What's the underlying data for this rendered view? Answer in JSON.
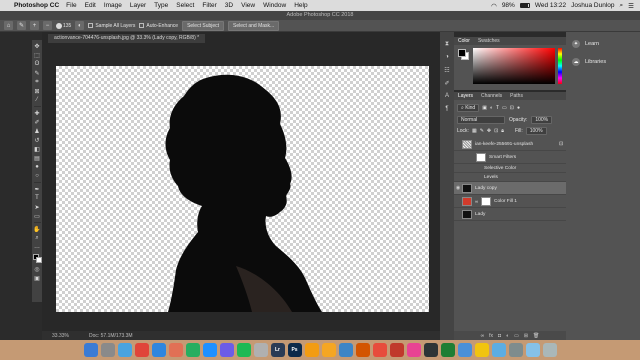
{
  "menubar": {
    "app_name": "Photoshop CC",
    "items": [
      "File",
      "Edit",
      "Image",
      "Layer",
      "Type",
      "Select",
      "Filter",
      "3D",
      "View",
      "Window",
      "Help"
    ],
    "battery": "98%",
    "clock": "Wed 13:22",
    "user": "Joshua Dunlop"
  },
  "window_title": "Adobe Photoshop CC 2018",
  "options": {
    "brush_size": "135",
    "sample_all_layers": "Sample All Layers",
    "auto_enhance": "Auto-Enhance",
    "select_subject": "Select Subject",
    "select_and_mask": "Select and Mask..."
  },
  "document": {
    "tab_title": "actionvance-704476-unsplash.jpg @ 33.3% (Lady copy, RGB/8) *",
    "zoom": "33.33%",
    "doc_size": "Doc: 57.1M/173.3M"
  },
  "color_panel": {
    "tabs": [
      "Color",
      "Swatches"
    ]
  },
  "layers_panel": {
    "tabs": [
      "Layers",
      "Channels",
      "Paths"
    ],
    "filter_kind": "Kind",
    "blend_mode": "Normal",
    "opacity_label": "Opacity:",
    "opacity_value": "100%",
    "lock_label": "Lock:",
    "fill_label": "Fill:",
    "fill_value": "100%",
    "layers": [
      {
        "name": "ian-keefe-255691-unsplash",
        "thumb": "check",
        "visible": false
      },
      {
        "name": "Smart Filters",
        "thumb": "white",
        "visible": false
      },
      {
        "name": "Selective Color",
        "thumb": "none",
        "visible": false
      },
      {
        "name": "Levels",
        "thumb": "none",
        "visible": false
      },
      {
        "name": "Lady copy",
        "thumb": "black",
        "visible": true
      },
      {
        "name": "Color Fill 1",
        "thumb": "red",
        "visible": false
      },
      {
        "name": "Lady",
        "thumb": "black",
        "visible": false
      }
    ]
  },
  "libraries": {
    "learn": "Learn",
    "libraries": "Libraries"
  },
  "dock": {
    "apps": [
      {
        "label": "",
        "color": "#3a7bd5"
      },
      {
        "label": "",
        "color": "#8a8a8a"
      },
      {
        "label": "",
        "color": "#4aa3df"
      },
      {
        "label": "",
        "color": "#e0453a"
      },
      {
        "label": "",
        "color": "#2e86de"
      },
      {
        "label": "",
        "color": "#e17055"
      },
      {
        "label": "",
        "color": "#27ae60"
      },
      {
        "label": "",
        "color": "#1e90ff"
      },
      {
        "label": "",
        "color": "#6c5ce7"
      },
      {
        "label": "",
        "color": "#1db954"
      },
      {
        "label": "",
        "color": "#b0b0b0"
      },
      {
        "label": "Lr",
        "color": "#2a3b55"
      },
      {
        "label": "Ps",
        "color": "#0c2a4a"
      },
      {
        "label": "",
        "color": "#f39c12"
      },
      {
        "label": "",
        "color": "#f5a623"
      },
      {
        "label": "",
        "color": "#3d85c6"
      },
      {
        "label": "",
        "color": "#d35400"
      },
      {
        "label": "",
        "color": "#e74c3c"
      },
      {
        "label": "",
        "color": "#c0392b"
      },
      {
        "label": "",
        "color": "#e84393"
      },
      {
        "label": "",
        "color": "#2d3436"
      },
      {
        "label": "",
        "color": "#1e7e34"
      },
      {
        "label": "",
        "color": "#4a90d9"
      },
      {
        "label": "",
        "color": "#f1c40f"
      },
      {
        "label": "",
        "color": "#5dade2"
      },
      {
        "label": "",
        "color": "#7f8c8d"
      },
      {
        "label": "",
        "color": "#85c1e9"
      },
      {
        "label": "",
        "color": "#aab7b8"
      }
    ]
  }
}
